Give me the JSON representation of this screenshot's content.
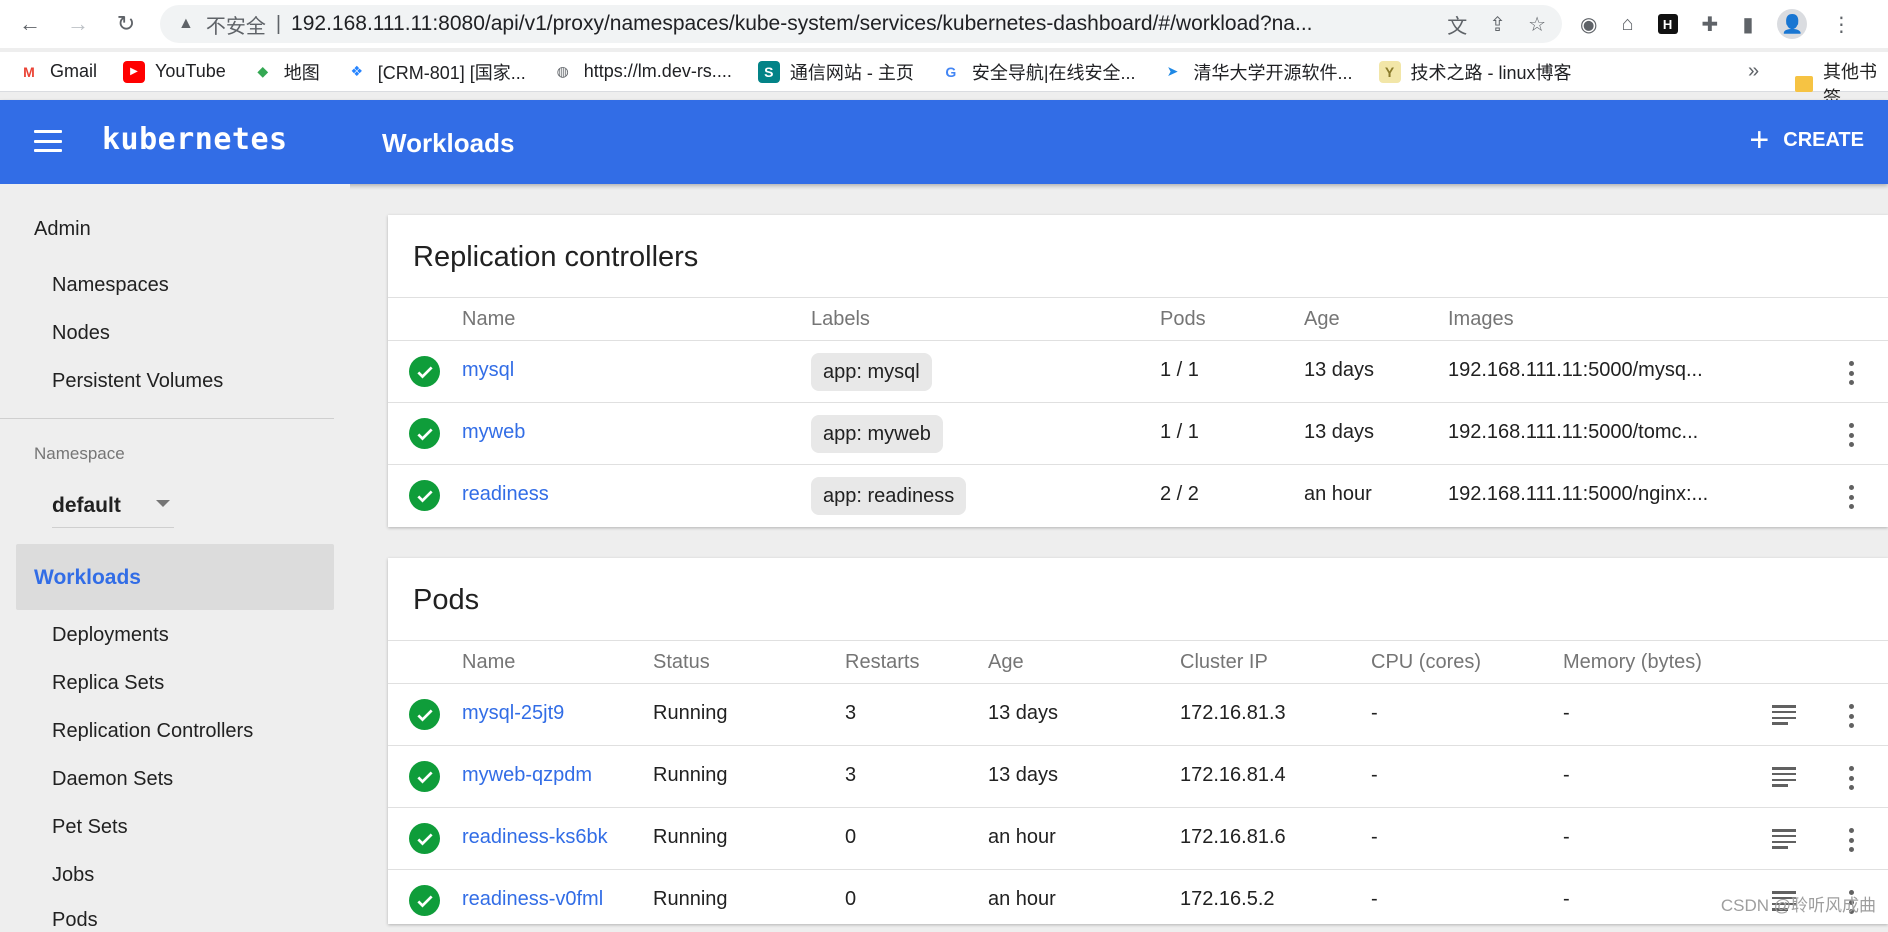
{
  "browser": {
    "security_label": "不安全",
    "url": "192.168.111.11:8080/api/v1/proxy/namespaces/kube-system/services/kubernetes-dashboard/#/workload?na...",
    "bookmarks": [
      {
        "label": "Gmail",
        "icon": "gmail-icon"
      },
      {
        "label": "YouTube",
        "icon": "youtube-icon"
      },
      {
        "label": "地图",
        "icon": "maps-icon"
      },
      {
        "label": "[CRM-801] [国家...",
        "icon": "jira-icon"
      },
      {
        "label": "https://lm.dev-rs....",
        "icon": "globe-icon"
      },
      {
        "label": "通信网站 - 主页",
        "icon": "sharepoint-icon"
      },
      {
        "label": "安全导航|在线安全...",
        "icon": "google-icon"
      },
      {
        "label": "清华大学开源软件...",
        "icon": "tuna-icon"
      },
      {
        "label": "技术之路 - linux博客",
        "icon": "blog-icon"
      }
    ],
    "more_bookmarks": "»",
    "other_bookmarks": "其他书签"
  },
  "header": {
    "brand": "kubernetes",
    "title": "Workloads",
    "create_label": "CREATE"
  },
  "sidebar": {
    "admin_label": "Admin",
    "admin_items": [
      "Namespaces",
      "Nodes",
      "Persistent Volumes"
    ],
    "namespace_label": "Namespace",
    "namespace_value": "default",
    "workloads_label": "Workloads",
    "workload_items": [
      "Deployments",
      "Replica Sets",
      "Replication Controllers",
      "Daemon Sets",
      "Pet Sets",
      "Jobs",
      "Pods"
    ]
  },
  "replication_controllers": {
    "title": "Replication controllers",
    "columns": [
      "Name",
      "Labels",
      "Pods",
      "Age",
      "Images"
    ],
    "rows": [
      {
        "name": "mysql",
        "label": "app: mysql",
        "pods": "1 / 1",
        "age": "13 days",
        "image": "192.168.111.11:5000/mysq..."
      },
      {
        "name": "myweb",
        "label": "app: myweb",
        "pods": "1 / 1",
        "age": "13 days",
        "image": "192.168.111.11:5000/tomc..."
      },
      {
        "name": "readiness",
        "label": "app: readiness",
        "pods": "2 / 2",
        "age": "an hour",
        "image": "192.168.111.11:5000/nginx:..."
      }
    ]
  },
  "pods": {
    "title": "Pods",
    "columns": [
      "Name",
      "Status",
      "Restarts",
      "Age",
      "Cluster IP",
      "CPU (cores)",
      "Memory (bytes)"
    ],
    "rows": [
      {
        "name": "mysql-25jt9",
        "status": "Running",
        "restarts": "3",
        "age": "13 days",
        "ip": "172.16.81.3",
        "cpu": "-",
        "memory": "-"
      },
      {
        "name": "myweb-qzpdm",
        "status": "Running",
        "restarts": "3",
        "age": "13 days",
        "ip": "172.16.81.4",
        "cpu": "-",
        "memory": "-"
      },
      {
        "name": "readiness-ks6bk",
        "status": "Running",
        "restarts": "0",
        "age": "an hour",
        "ip": "172.16.81.6",
        "cpu": "-",
        "memory": "-"
      },
      {
        "name": "readiness-v0fml",
        "status": "Running",
        "restarts": "0",
        "age": "an hour",
        "ip": "172.16.5.2",
        "cpu": "-",
        "memory": "-"
      }
    ]
  },
  "watermark": "CSDN @聆听风成曲",
  "colors": {
    "brand": "#326de6",
    "success": "#0f9d3a"
  }
}
